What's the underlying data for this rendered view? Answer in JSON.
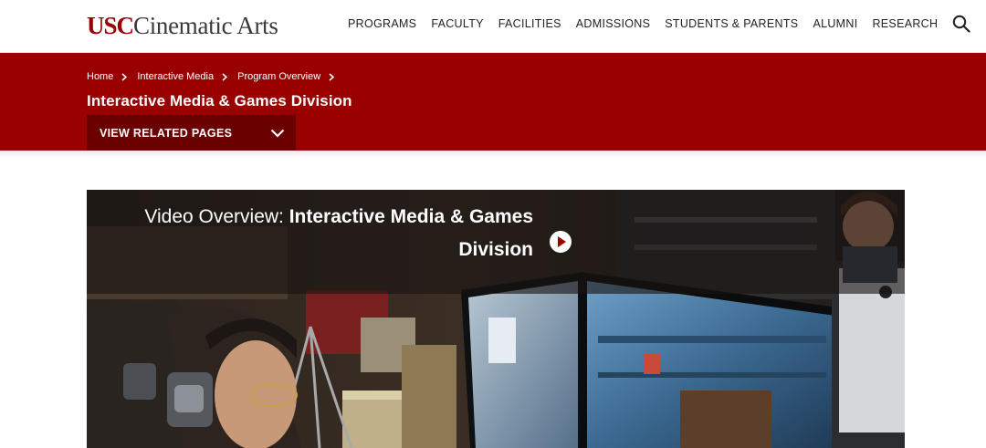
{
  "header": {
    "logo": {
      "usc": "USC",
      "cinematic": "Cinematic Arts"
    },
    "nav": [
      {
        "label": "PROGRAMS"
      },
      {
        "label": "FACULTY"
      },
      {
        "label": "FACILITIES"
      },
      {
        "label": "ADMISSIONS"
      },
      {
        "label": "STUDENTS & PARENTS"
      },
      {
        "label": "ALUMNI"
      },
      {
        "label": "RESEARCH"
      }
    ],
    "search_icon": "search-icon"
  },
  "banner": {
    "breadcrumb": [
      {
        "label": "Home"
      },
      {
        "label": "Interactive Media"
      },
      {
        "label": "Program Overview"
      }
    ],
    "title": "Interactive Media & Games Division",
    "related_label": "VIEW RELATED PAGES",
    "related_icon": "chevron-down-icon"
  },
  "video": {
    "prefix": "Video Overview: ",
    "title": "Interactive Media & Games Division",
    "play_icon": "play-icon"
  },
  "colors": {
    "brand_red": "#990000",
    "dark_red": "#6b0000",
    "text": "#222222"
  }
}
